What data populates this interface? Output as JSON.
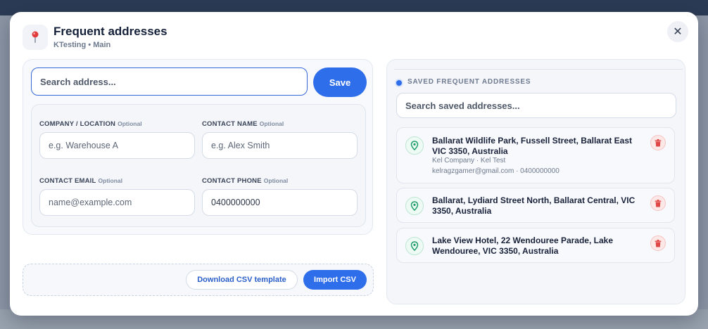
{
  "modal": {
    "title": "Frequent addresses",
    "subtitle": "KTesting • Main",
    "close_glyph": "✕"
  },
  "form": {
    "search_placeholder": "Search address...",
    "save_label": "Save",
    "optional_tag": "Optional",
    "company_label": "COMPANY / LOCATION",
    "company_placeholder": "e.g. Warehouse A",
    "contact_name_label": "CONTACT NAME",
    "contact_name_placeholder": "e.g. Alex Smith",
    "contact_email_label": "CONTACT EMAIL",
    "contact_email_placeholder": "name@example.com",
    "contact_phone_label": "CONTACT PHONE",
    "contact_phone_value": "0400000000"
  },
  "csv": {
    "template_label": "Download CSV template",
    "import_label": "Import CSV"
  },
  "saved": {
    "heading": "SAVED FREQUENT ADDRESSES",
    "search_placeholder": "Search saved addresses...",
    "items": [
      {
        "address": "Ballarat Wildlife Park, Fussell Street, Ballarat East VIC 3350, Australia",
        "meta1": "Kel Company · Kel Test",
        "meta2": "kelragzgamer@gmail.com · 0400000000"
      },
      {
        "address": "Ballarat, Lydiard Street North, Ballarat Central, VIC 3350, Australia"
      },
      {
        "address": "Lake View Hotel, 22 Wendouree Parade, Lake Wendouree, VIC 3350, Australia"
      }
    ]
  },
  "colors": {
    "accent": "#2f6eea",
    "pin_green": "#1f9d6a",
    "delete_red": "#e04848"
  },
  "icons": {
    "header": "map-pin-icon",
    "close": "close-icon",
    "address": "location-pin-icon",
    "delete": "trash-icon"
  }
}
